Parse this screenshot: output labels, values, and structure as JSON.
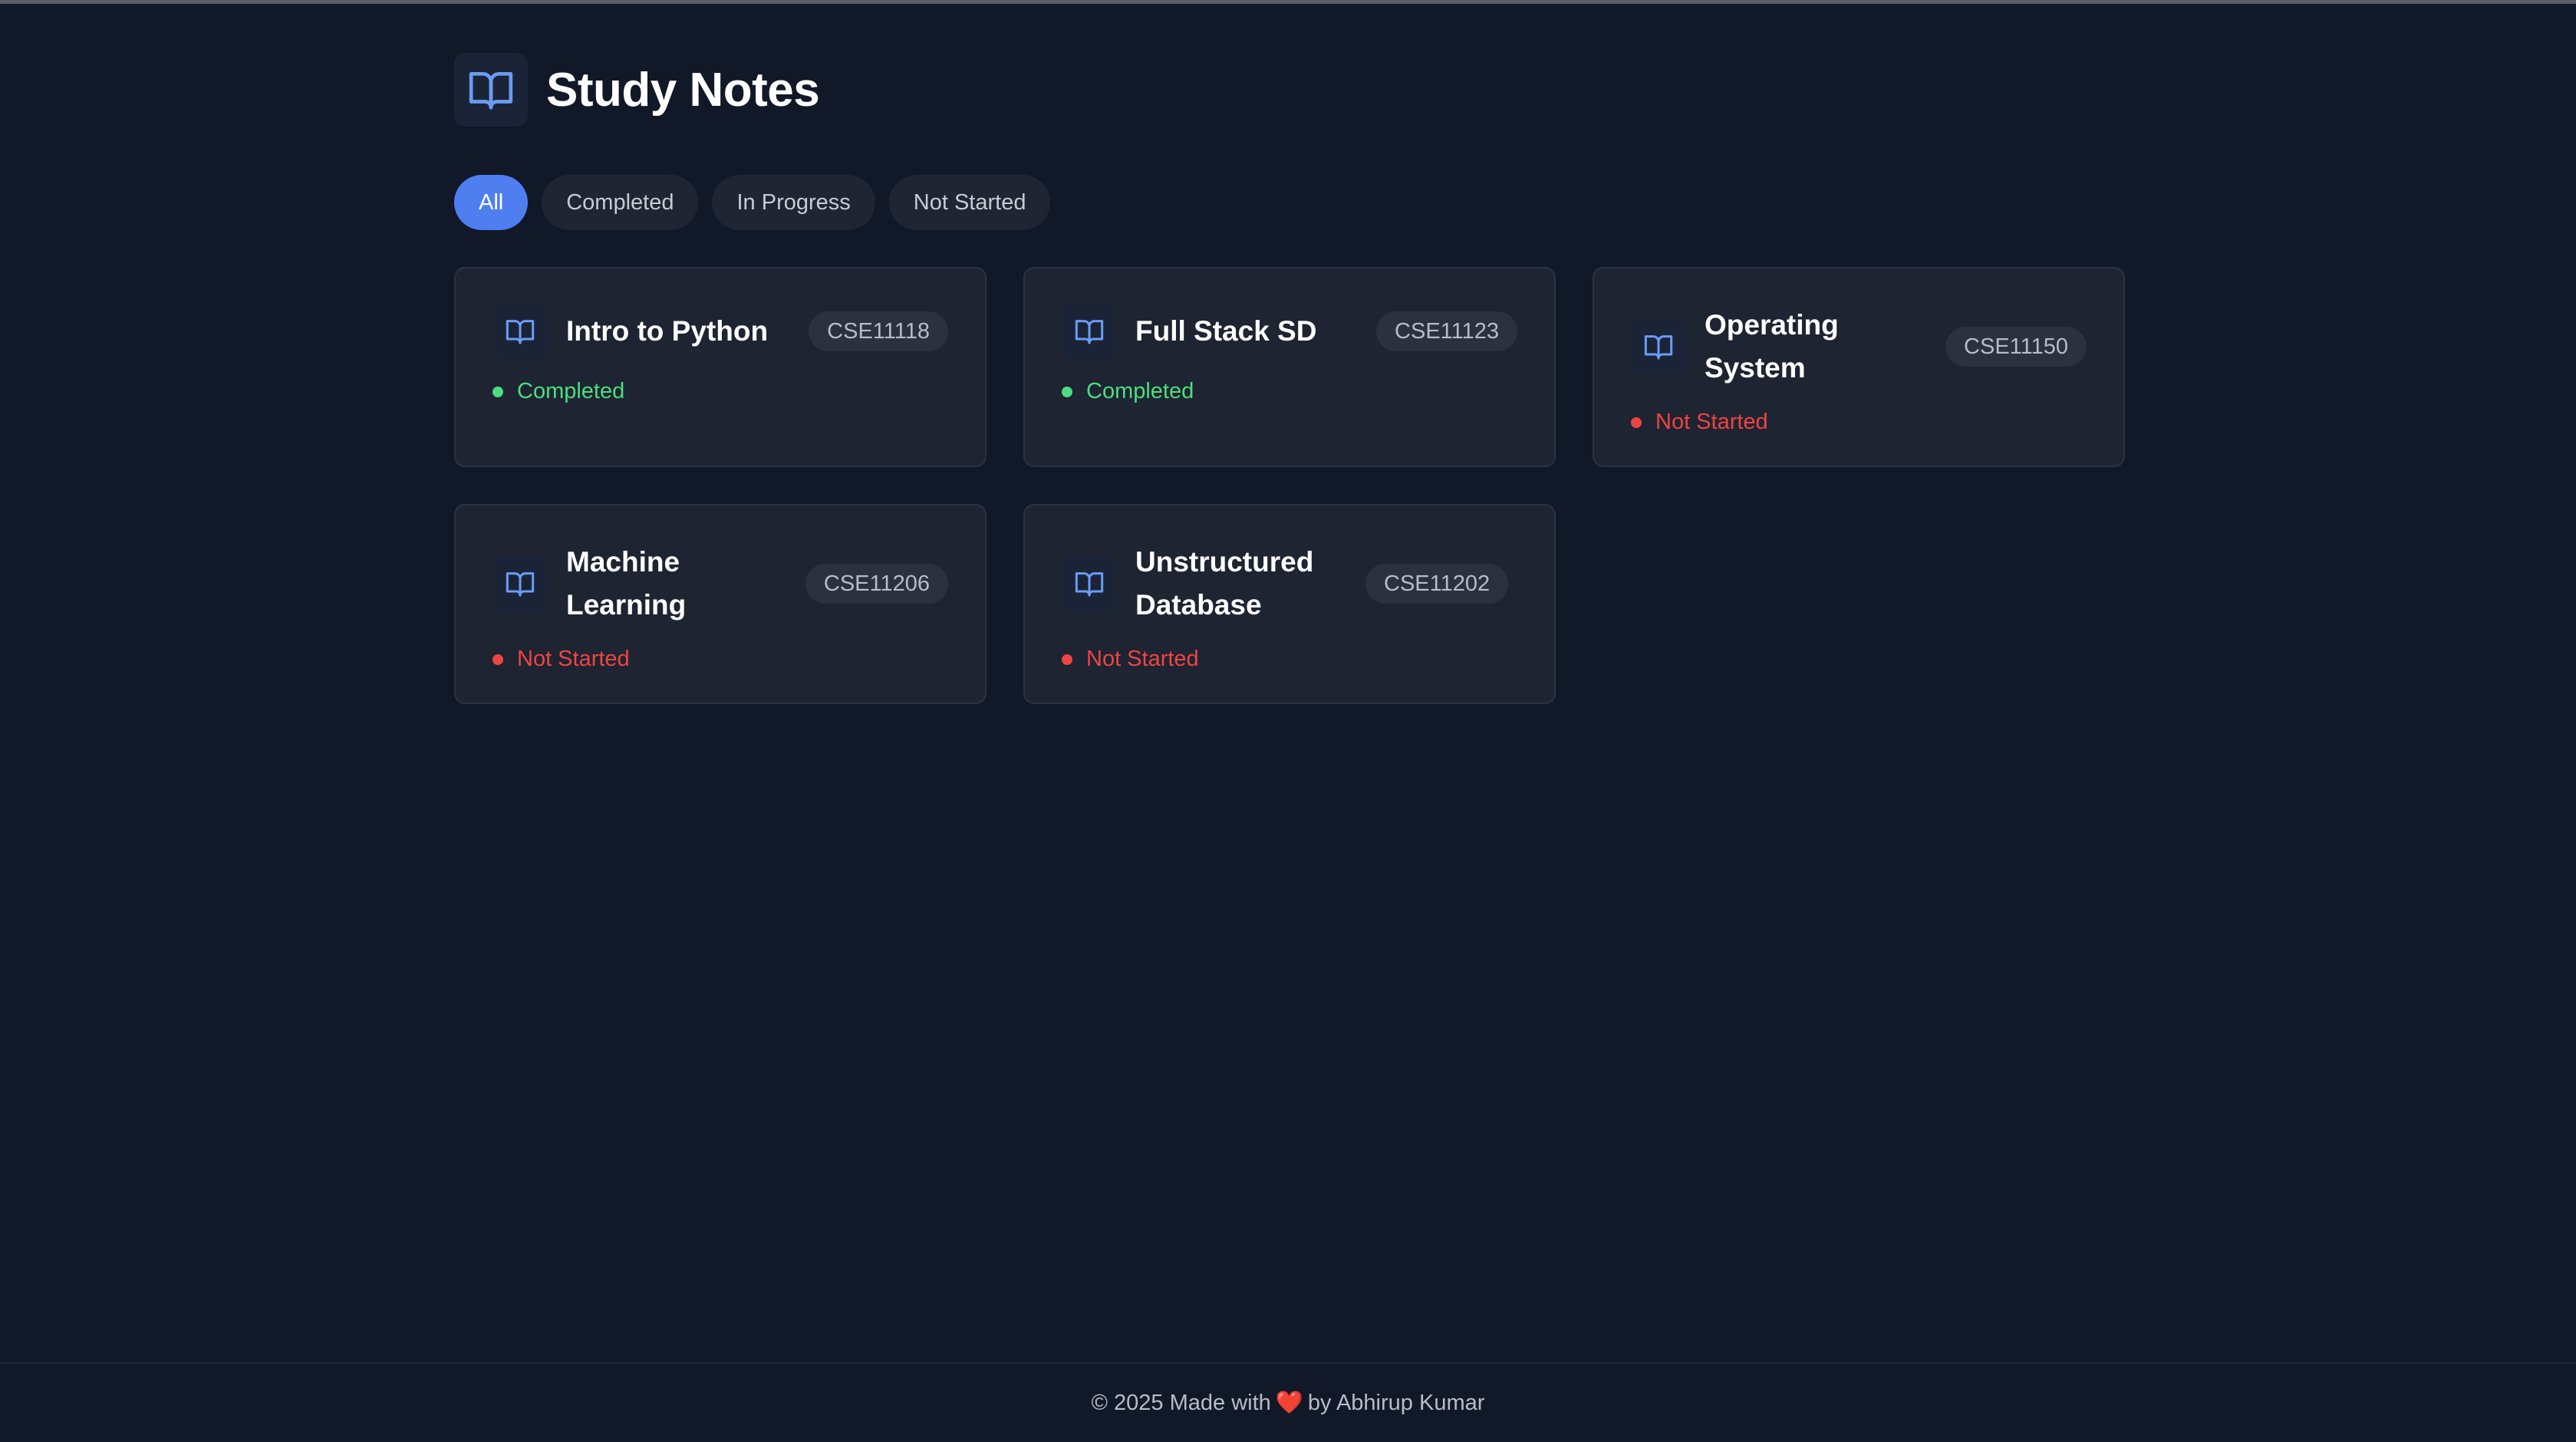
{
  "page": {
    "title": "Study Notes"
  },
  "filters": [
    {
      "label": "All",
      "active": true
    },
    {
      "label": "Completed",
      "active": false
    },
    {
      "label": "In Progress",
      "active": false
    },
    {
      "label": "Not Started",
      "active": false
    }
  ],
  "cards": [
    {
      "title": "Intro to Python",
      "code": "CSE11118",
      "status": "Completed",
      "status_color": "#4ade80"
    },
    {
      "title": "Full Stack SD",
      "code": "CSE11123",
      "status": "Completed",
      "status_color": "#4ade80"
    },
    {
      "title": "Operating System",
      "code": "CSE11150",
      "status": "Not Started",
      "status_color": "#ef4444"
    },
    {
      "title": "Machine Learning",
      "code": "CSE11206",
      "status": "Not Started",
      "status_color": "#ef4444"
    },
    {
      "title": "Unstructured Database",
      "code": "CSE11202",
      "status": "Not Started",
      "status_color": "#ef4444"
    }
  ],
  "icons": {
    "header": "open-book-icon",
    "card": "open-book-icon",
    "footer_heart": "heart-icon"
  },
  "colors": {
    "accent": "#4f7ef0",
    "background": "#111827",
    "card": "#1e2431",
    "completed": "#4ade80",
    "not_started": "#ef4444"
  },
  "footer": {
    "prefix": "© 2025 Made with",
    "heart": "❤️",
    "suffix": "by Abhirup Kumar"
  }
}
